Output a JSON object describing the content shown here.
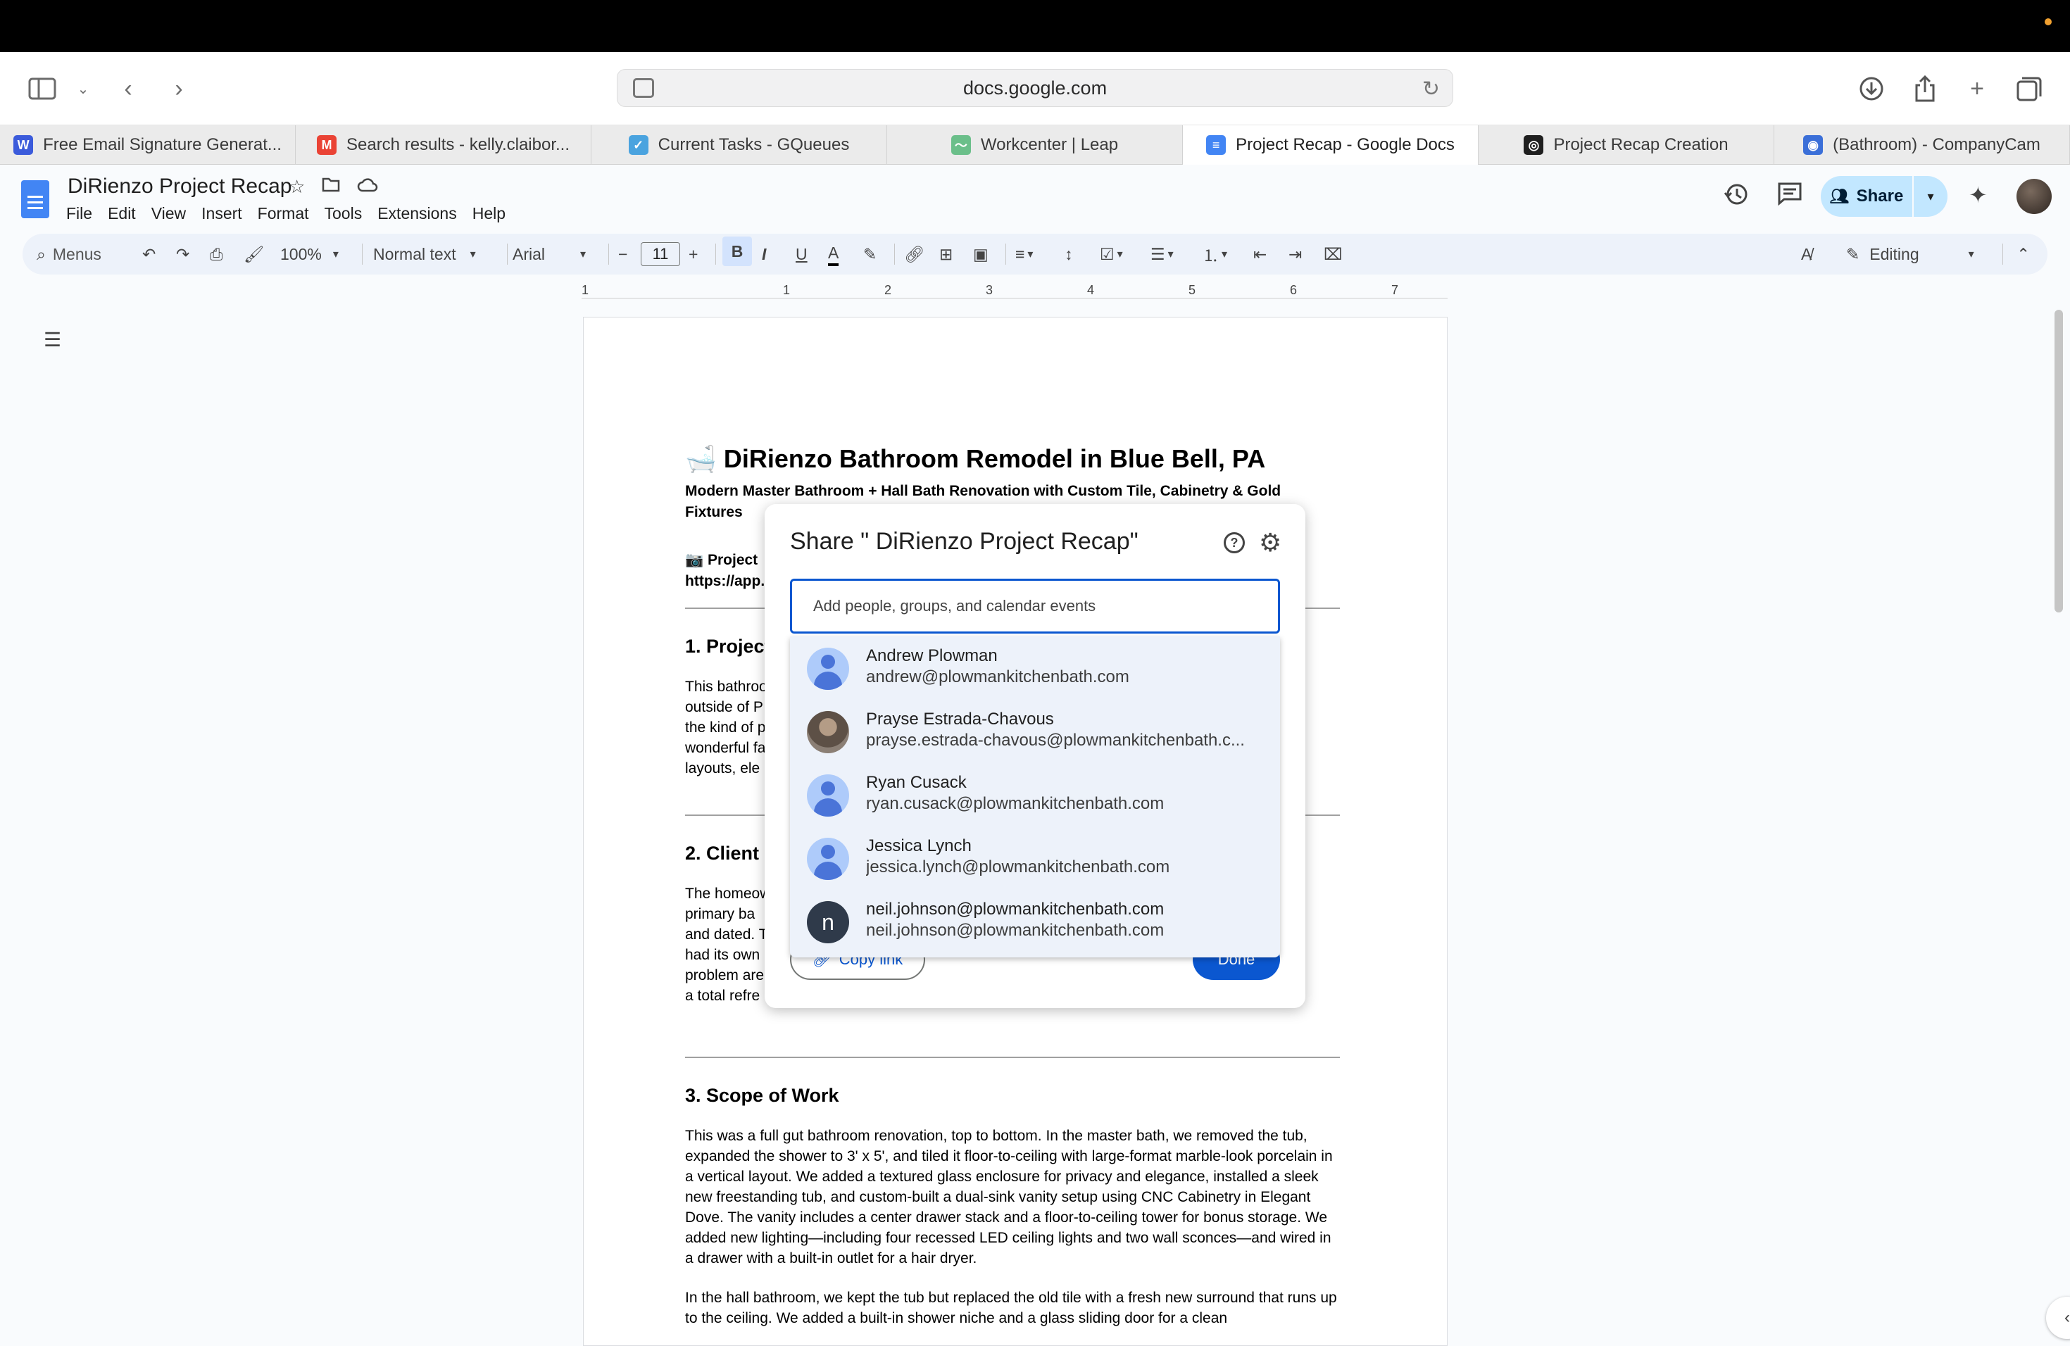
{
  "browser": {
    "url": "docs.google.com",
    "tabs": [
      {
        "label": "Free Email Signature Generat...",
        "icon": "wisestamp-icon",
        "color": "#3b5bdb",
        "glyph": "W"
      },
      {
        "label": "Search results - kelly.claibor...",
        "icon": "gmail-icon",
        "color": "#ea4335",
        "glyph": "M"
      },
      {
        "label": "Current Tasks - GQueues",
        "icon": "gqueues-icon",
        "color": "#4aa3df",
        "glyph": "✓"
      },
      {
        "label": "Workcenter | Leap",
        "icon": "leap-icon",
        "color": "#6bbf8a",
        "glyph": "〜"
      },
      {
        "label": "Project Recap - Google Docs",
        "icon": "google-docs-icon",
        "color": "#4285f4",
        "glyph": "≡"
      },
      {
        "label": "Project Recap Creation",
        "icon": "openai-icon",
        "color": "#1f1f1f",
        "glyph": "◎"
      },
      {
        "label": "(Bathroom) - CompanyCam",
        "icon": "companycam-icon",
        "color": "#3b6fd8",
        "glyph": "◉"
      }
    ]
  },
  "docs": {
    "title": "DiRienzo Project Recap",
    "menu": [
      "File",
      "Edit",
      "View",
      "Insert",
      "Format",
      "Tools",
      "Extensions",
      "Help"
    ],
    "share_label": "Share",
    "toolbar": {
      "menus_label": "Menus",
      "zoom": "100%",
      "style": "Normal text",
      "font": "Arial",
      "font_size": "11",
      "mode": "Editing"
    },
    "ruler_marks": [
      "1",
      "1",
      "2",
      "3",
      "4",
      "5",
      "6",
      "7"
    ]
  },
  "document": {
    "heading": "🛁 DiRienzo Bathroom Remodel in Blue Bell, PA",
    "subtitle": "Modern Master Bathroom + Hall Bath Renovation with Custom Tile, Cabinetry & Gold Fixtures",
    "project_link_label": "📷 Project",
    "project_link_url": "https://app.",
    "section1_heading": "1. Project",
    "section1_lines": [
      "This bathroo",
      "outside of P",
      "the kind of p",
      "wonderful fa",
      "layouts, ele"
    ],
    "section2_heading": "2. Client C",
    "section2_lines": [
      "The homeow",
      "primary ba",
      "and dated. T",
      "had its own",
      "problem are",
      "a total refre"
    ],
    "section3_heading": "3. Scope of Work",
    "section3_p1": "This was a full gut bathroom renovation, top to bottom. In the master bath, we removed the tub, expanded the shower to 3' x 5', and tiled it floor-to-ceiling with large-format marble-look porcelain in a vertical layout. We added a textured glass enclosure for privacy and elegance, installed a sleek new freestanding tub, and custom-built a dual-sink vanity setup using CNC Cabinetry in Elegant Dove. The vanity includes a center drawer stack and a floor-to-ceiling tower for bonus storage. We added new lighting—including four recessed LED ceiling lights and two wall sconces—and wired in a drawer with a built-in outlet for a hair dryer.",
    "section3_p2": "In the hall bathroom, we kept the tub but replaced the old tile with a fresh new surround that runs up to the ceiling. We added a built-in shower niche and a glass sliding door for a clean"
  },
  "share_dialog": {
    "title": "Share \" DiRienzo Project Recap\"",
    "input_placeholder": "Add people, groups, and calendar events",
    "copy_link_label": "Copy link",
    "done_label": "Done",
    "suggestions": [
      {
        "name": "Andrew Plowman",
        "email": "andrew@plowmankitchenbath.com",
        "avatar": "default"
      },
      {
        "name": "Prayse Estrada-Chavous",
        "email": "prayse.estrada-chavous@plowmankitchenbath.c...",
        "avatar": "photo"
      },
      {
        "name": "Ryan Cusack",
        "email": "ryan.cusack@plowmankitchenbath.com",
        "avatar": "default"
      },
      {
        "name": "Jessica Lynch",
        "email": "jessica.lynch@plowmankitchenbath.com",
        "avatar": "default"
      },
      {
        "name": "neil.johnson@plowmankitchenbath.com",
        "email": "neil.johnson@plowmankitchenbath.com",
        "avatar": "letter",
        "letter": "n"
      }
    ]
  }
}
